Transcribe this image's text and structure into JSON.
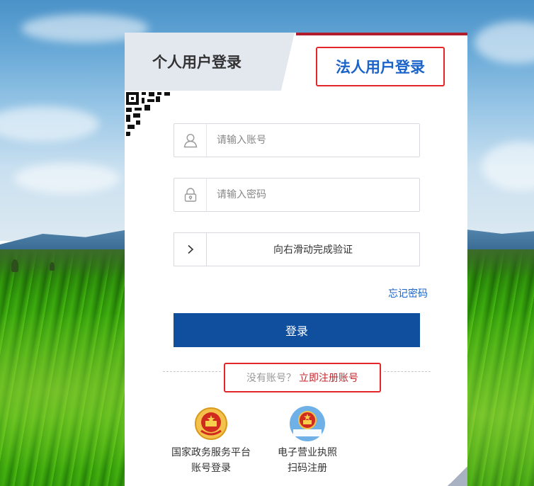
{
  "tabs": {
    "personal": "个人用户登录",
    "corporate": "法人用户登录"
  },
  "form": {
    "account_placeholder": "请输入账号",
    "password_placeholder": "请输入密码",
    "slider_text": "向右滑动完成验证",
    "forgot_password": "忘记密码",
    "login_button": "登录"
  },
  "register": {
    "question": "没有账号？",
    "link": "立即注册账号"
  },
  "alt_logins": [
    {
      "line1": "国家政务服务平台",
      "line2": "账号登录",
      "icon": "national-emblem-icon"
    },
    {
      "line1": "电子营业执照",
      "line2": "扫码注册",
      "icon": "business-license-emblem-icon",
      "badge": "电子营业执照"
    }
  ],
  "colors": {
    "primary_blue": "#0f4f9e",
    "link_blue": "#1b63c9",
    "accent_red": "#c1272d",
    "highlight_red": "#e2262a",
    "tab_inactive_bg": "#e3e7ee"
  }
}
